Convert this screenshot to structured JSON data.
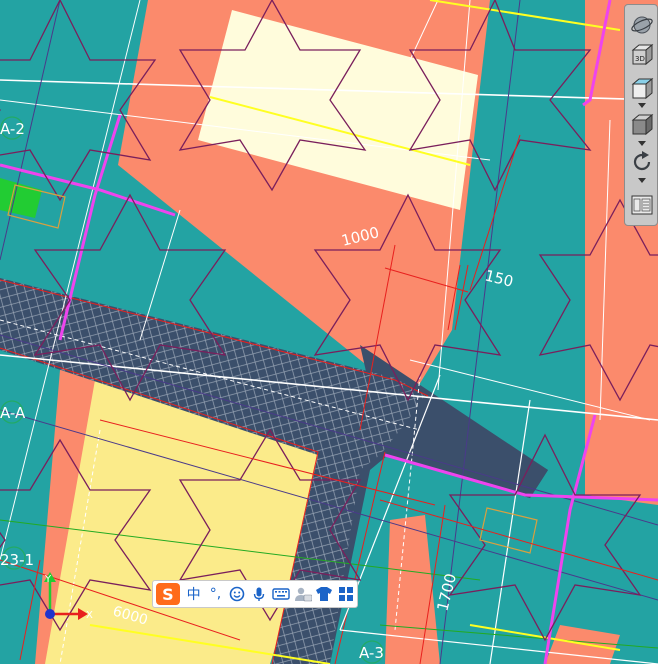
{
  "drawing": {
    "grid_labels": {
      "a2": "A-2",
      "aa": "A-A",
      "a23": "23-1",
      "a3": "A-3"
    },
    "dimensions": {
      "d1000": "1000",
      "d150": "150",
      "d1700": "1700",
      "d6000": "6000"
    },
    "ucs": {
      "x_label": "X",
      "y_label": "Y"
    },
    "colors": {
      "background": "#23a3a3",
      "salmon": "#fb8a6c",
      "cream": "#fffcdc",
      "yellow_fill": "#fbeb8a",
      "slab": "#3b4f6b",
      "magenta": "#ee44ee",
      "grid_white": "#ffffff",
      "star_outline": "#7a1f5c",
      "dim_red": "#e8201e"
    }
  },
  "view_toolbar": {
    "buttons": [
      "view-orbit",
      "view-3d-box",
      "view-front-box",
      "view-box",
      "view-rotate",
      "view-layout"
    ]
  },
  "ime_toolbar": {
    "logo": "S",
    "lang": "中",
    "punct": "°,",
    "items": [
      "emoji",
      "microphone",
      "keyboard",
      "user",
      "skin",
      "toolbox"
    ]
  }
}
